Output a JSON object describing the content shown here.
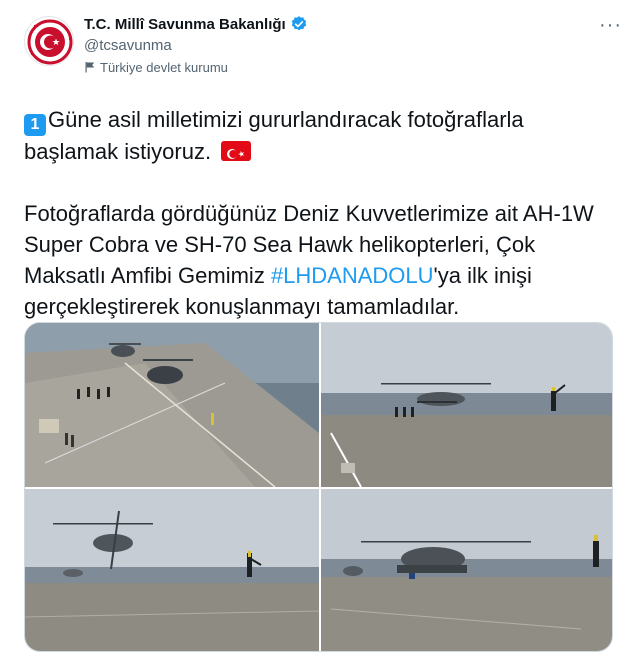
{
  "account": {
    "display_name": "T.C. Millî Savunma Bakanlığı",
    "handle": "@tcsavunma",
    "label": "Türkiye devlet kurumu",
    "verified": true
  },
  "menu": {
    "more_label": "···"
  },
  "tweet": {
    "keycap": "1",
    "line1": "Güne asil milletimizi gururlandıracak fotoğraflarla başlamak istiyoruz.",
    "para2_before": "Fotoğraflarda gördüğünüz Deniz Kuvvetlerimize ait AH-1W Super Cobra ve SH-70 Sea Hawk helikopterleri, Çok Maksatlı Amfibi Gemimiz ",
    "hashtag": "#LHDANADOLU",
    "para2_after": "'ya ilk inişi gerçekleştirerek konuşlanmayı tamamladılar."
  },
  "colors": {
    "link": "#1d9bf0",
    "secondary_text": "#536471",
    "flag_red": "#e30a17"
  },
  "icons": [
    "seal-avatar-icon",
    "verified-badge-icon",
    "flag-icon",
    "more-icon",
    "keycap-one-icon",
    "turkey-flag-icon"
  ]
}
